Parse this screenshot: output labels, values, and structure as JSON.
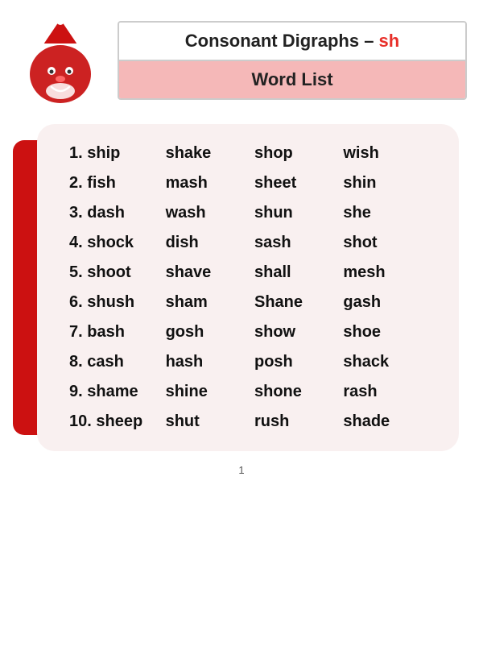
{
  "header": {
    "title_part1": "Consonant Digraphs – ",
    "title_highlight": "sh",
    "subtitle": "Word List"
  },
  "words": [
    [
      "1. ship",
      "shake",
      "shop",
      "wish"
    ],
    [
      "2. fish",
      "mash",
      "sheet",
      "shin"
    ],
    [
      "3. dash",
      "wash",
      "shun",
      "she"
    ],
    [
      "4. shock",
      "dish",
      "sash",
      "shot"
    ],
    [
      "5. shoot",
      "shave",
      "shall",
      "mesh"
    ],
    [
      "6. shush",
      "sham",
      "Shane",
      "gash"
    ],
    [
      "7. bash",
      "gosh",
      "show",
      "shoe"
    ],
    [
      "8. cash",
      "hash",
      "posh",
      "shack"
    ],
    [
      "9. shame",
      "shine",
      "shone",
      "rash"
    ],
    [
      "10. sheep",
      "shut",
      "rush",
      "shade"
    ]
  ],
  "footer": {
    "page_number": "1"
  }
}
